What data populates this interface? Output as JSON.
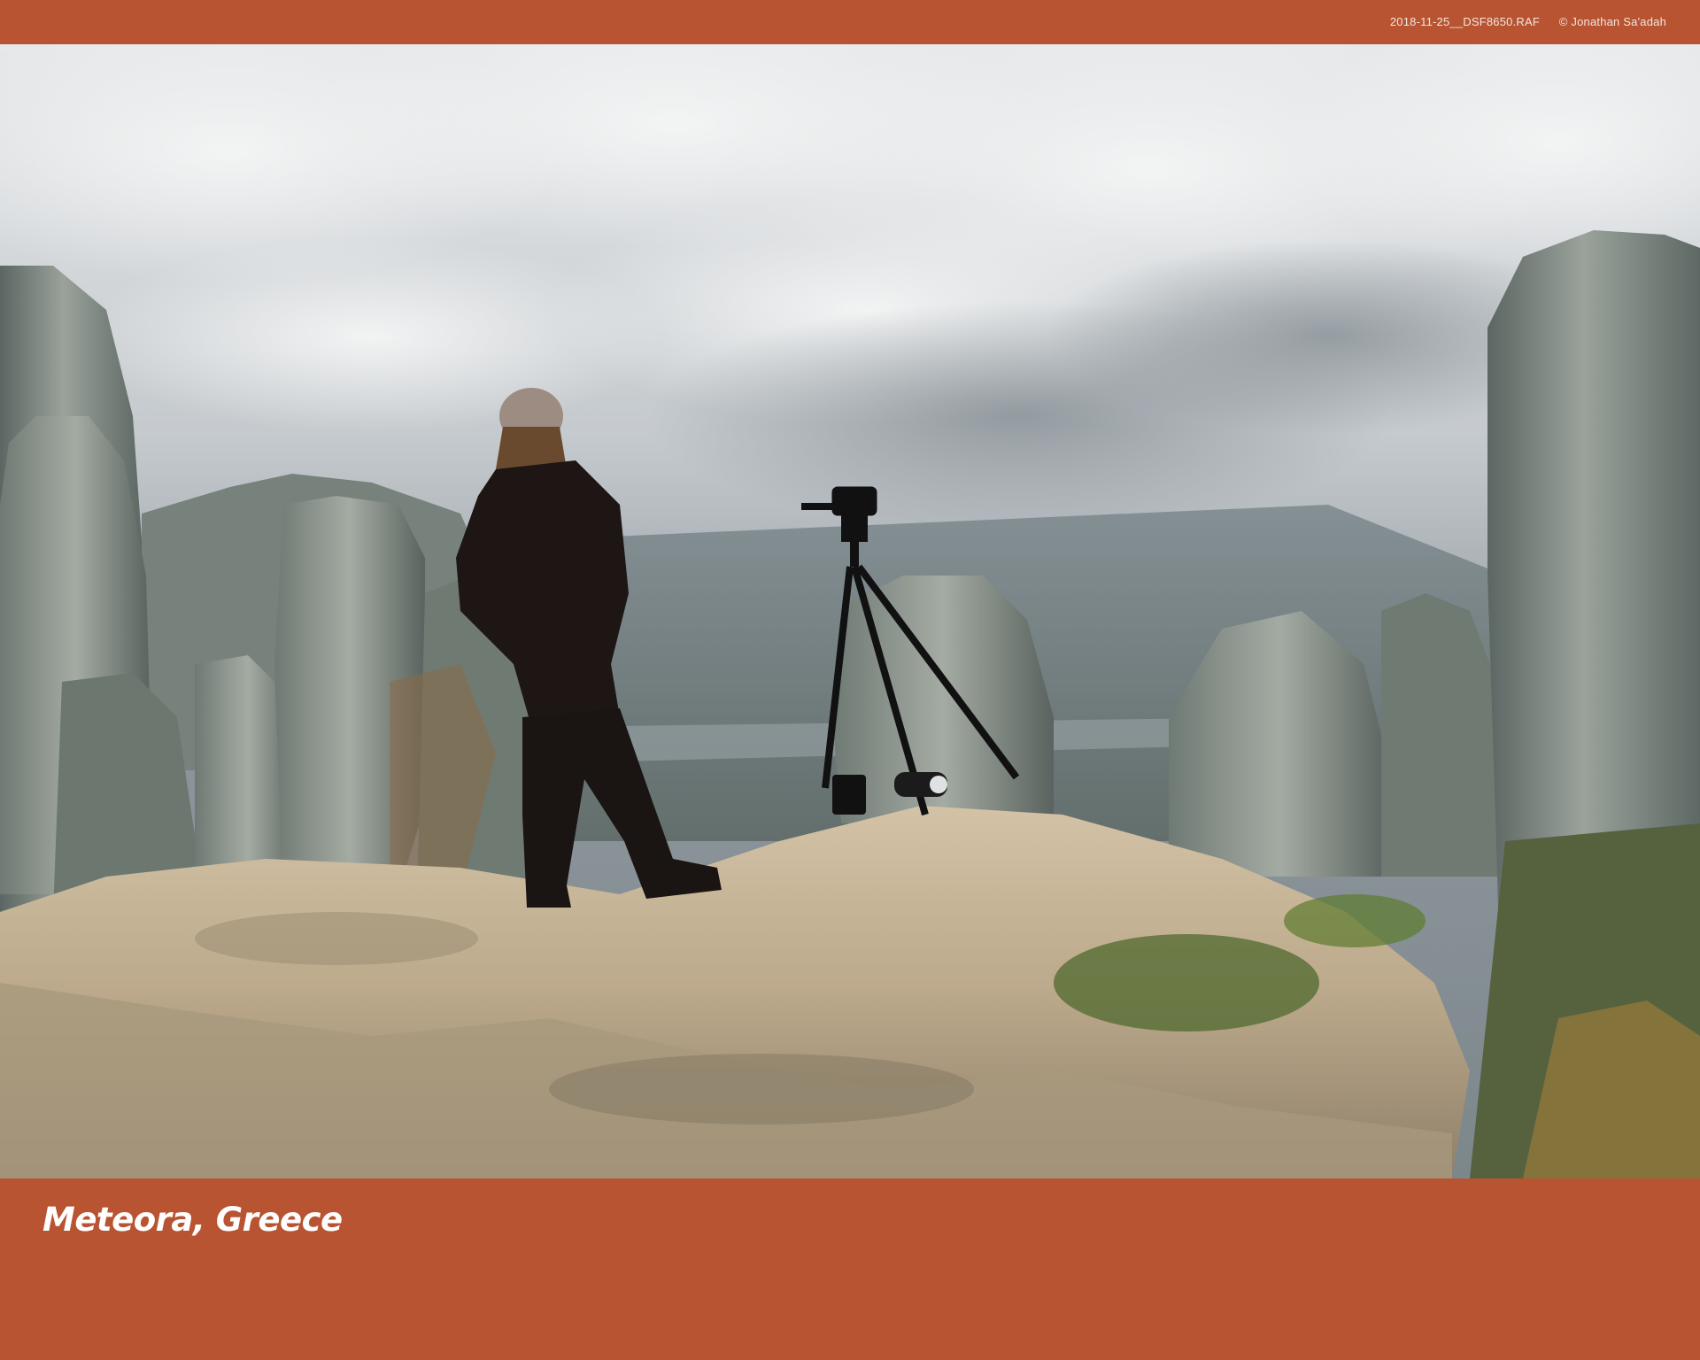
{
  "header": {
    "file_name": "2018-11-25__DSF8650.RAF",
    "credit": "© Jonathan Sa'adah"
  },
  "photo": {
    "scene": "photographer-on-rock-with-tripod",
    "colors": {
      "frame": "#b85431",
      "sky": "#c9ced2",
      "rock": "#c9b79b",
      "silhouette": "#1d1615"
    }
  },
  "caption": {
    "text": "Meteora, Greece"
  }
}
